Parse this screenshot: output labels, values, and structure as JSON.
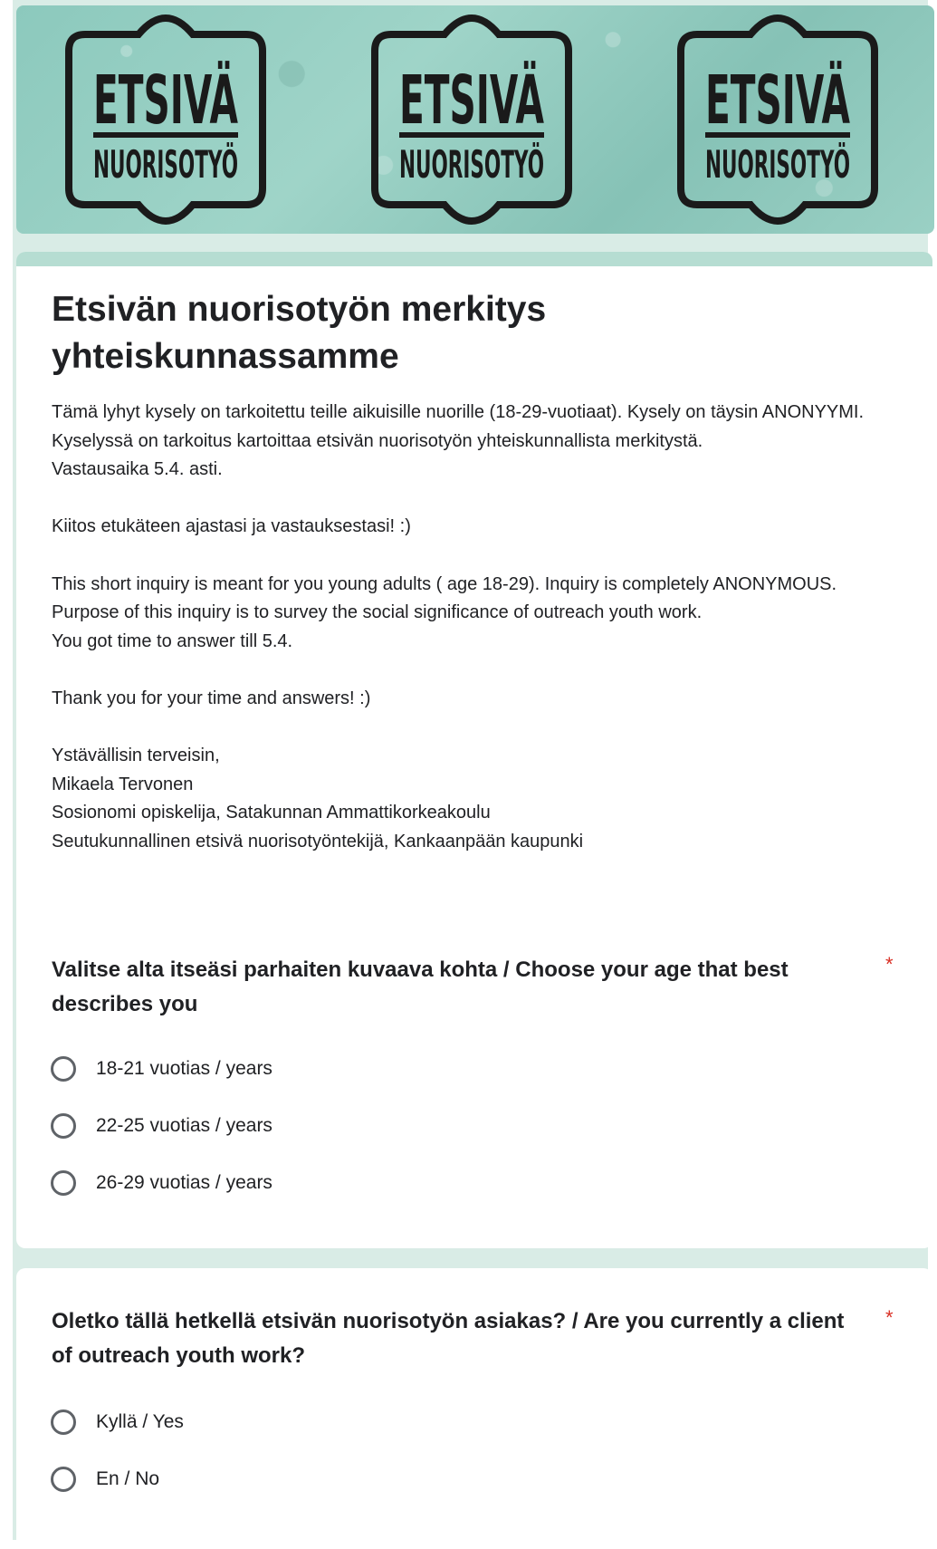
{
  "banner": {
    "logo_top": "ETSIVÄ",
    "logo_bottom": "NUORISOTYÖ"
  },
  "form": {
    "title": "Etsivän nuorisotyön merkitys yhteiskunnassamme",
    "description": "Tämä lyhyt kysely on tarkoitettu teille aikuisille nuorille (18-29-vuotiaat). Kysely on täysin ANONYYMI. Kyselyssä on tarkoitus kartoittaa etsivän nuorisotyön yhteiskunnallista merkitystä.\nVastausaika 5.4. asti.\n\nKiitos etukäteen ajastasi ja vastauksestasi! :)\n\nThis short inquiry is meant for you young adults ( age 18-29). Inquiry is completely ANONYMOUS. Purpose of this inquiry is to survey the social significance of outreach youth work.\nYou got time to answer till 5.4.\n\nThank you for your time and answers! :)\n\nYstävällisin terveisin,\nMikaela Tervonen\nSosionomi opiskelija, Satakunnan Ammattikorkeakoulu\nSeutukunnallinen etsivä nuorisotyöntekijä, Kankaanpään kaupunki"
  },
  "questions": [
    {
      "title": "Valitse alta itseäsi parhaiten kuvaava kohta / Choose your age that best describes you",
      "required_mark": "*",
      "options": [
        "18-21 vuotias / years",
        "22-25 vuotias / years",
        "26-29 vuotias / years"
      ]
    },
    {
      "title": "Oletko tällä hetkellä etsivän nuorisotyön asiakas? / Are you currently a client of outreach youth work?",
      "required_mark": "*",
      "options": [
        "Kyllä / Yes",
        "En / No"
      ]
    }
  ],
  "colors": {
    "accent": "#b6ddd2",
    "background": "#d9ece6",
    "required": "#d93025"
  }
}
